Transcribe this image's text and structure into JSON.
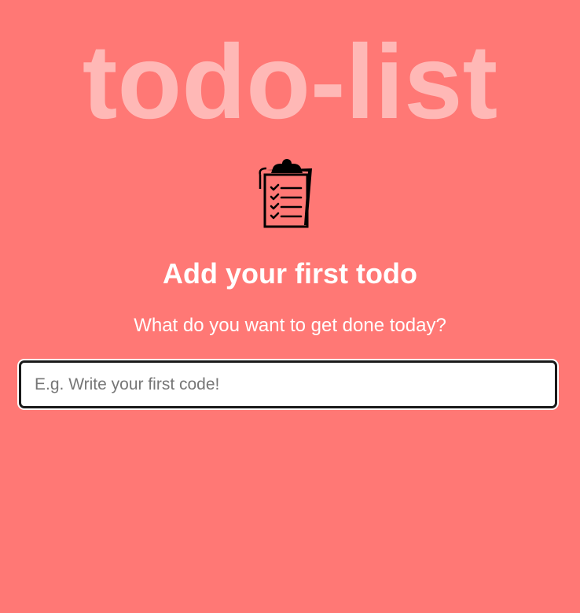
{
  "app": {
    "title": "todo-list",
    "background_color": "#ff7875",
    "title_color": "#ffb8b6"
  },
  "empty_state": {
    "icon": "clipboard-checklist-icon",
    "heading": "Add your first todo",
    "subheading": "What do you want to get done today?"
  },
  "todo_input": {
    "placeholder": "E.g. Write your first code!",
    "value": ""
  }
}
